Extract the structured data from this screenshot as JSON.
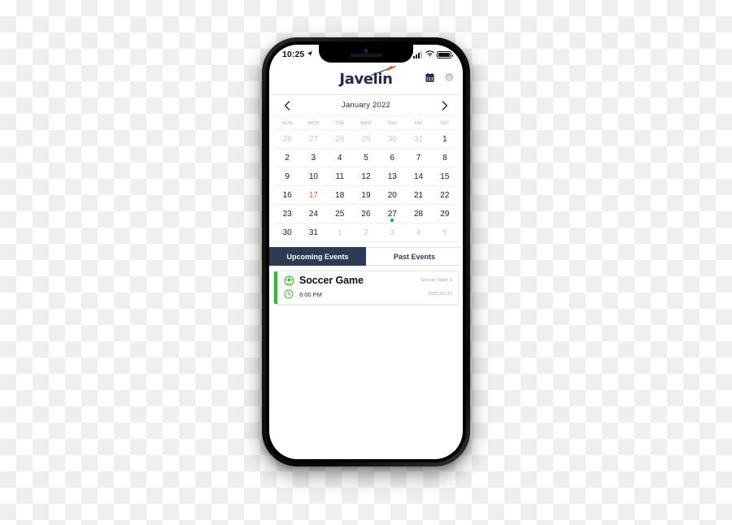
{
  "device": {
    "status_bar": {
      "time": "10:25",
      "location_icon": "location-arrow-icon",
      "signal_icon": "cellular-signal-icon",
      "wifi_icon": "wifi-icon",
      "battery_icon": "battery-full-icon"
    }
  },
  "app": {
    "brand": "Javelin",
    "brand_color": "#1d2b4c",
    "accent_color": "#21c521",
    "today_color": "#e8562a",
    "tab_active_bg": "#2b3a55",
    "header_icons": [
      {
        "name": "calendar-icon",
        "label": "Calendar"
      },
      {
        "name": "gear-icon",
        "label": "Settings"
      }
    ]
  },
  "calendar": {
    "prev_label": "‹",
    "next_label": "›",
    "month_label": "January 2022",
    "day_headers": [
      "SUN",
      "MON",
      "TUE",
      "WED",
      "THU",
      "FRI",
      "SAT"
    ],
    "weeks": [
      [
        {
          "day": "26",
          "state": "muted"
        },
        {
          "day": "27",
          "state": "muted"
        },
        {
          "day": "28",
          "state": "muted"
        },
        {
          "day": "29",
          "state": "muted"
        },
        {
          "day": "30",
          "state": "muted"
        },
        {
          "day": "31",
          "state": "muted"
        },
        {
          "day": "1",
          "state": "normal"
        }
      ],
      [
        {
          "day": "2",
          "state": "normal"
        },
        {
          "day": "3",
          "state": "normal"
        },
        {
          "day": "4",
          "state": "normal"
        },
        {
          "day": "5",
          "state": "normal"
        },
        {
          "day": "6",
          "state": "normal"
        },
        {
          "day": "7",
          "state": "normal"
        },
        {
          "day": "8",
          "state": "normal"
        }
      ],
      [
        {
          "day": "9",
          "state": "normal"
        },
        {
          "day": "10",
          "state": "normal"
        },
        {
          "day": "11",
          "state": "normal"
        },
        {
          "day": "12",
          "state": "normal"
        },
        {
          "day": "13",
          "state": "normal"
        },
        {
          "day": "14",
          "state": "normal"
        },
        {
          "day": "15",
          "state": "normal"
        }
      ],
      [
        {
          "day": "16",
          "state": "normal"
        },
        {
          "day": "17",
          "state": "today"
        },
        {
          "day": "18",
          "state": "normal"
        },
        {
          "day": "19",
          "state": "normal"
        },
        {
          "day": "20",
          "state": "normal"
        },
        {
          "day": "21",
          "state": "normal"
        },
        {
          "day": "22",
          "state": "normal"
        }
      ],
      [
        {
          "day": "23",
          "state": "normal"
        },
        {
          "day": "24",
          "state": "normal"
        },
        {
          "day": "25",
          "state": "normal"
        },
        {
          "day": "26",
          "state": "normal"
        },
        {
          "day": "27",
          "state": "normal",
          "has_event": true
        },
        {
          "day": "28",
          "state": "normal"
        },
        {
          "day": "29",
          "state": "normal"
        }
      ],
      [
        {
          "day": "30",
          "state": "normal"
        },
        {
          "day": "31",
          "state": "normal"
        },
        {
          "day": "1",
          "state": "muted"
        },
        {
          "day": "2",
          "state": "muted"
        },
        {
          "day": "3",
          "state": "muted"
        },
        {
          "day": "4",
          "state": "muted"
        },
        {
          "day": "5",
          "state": "muted"
        }
      ]
    ]
  },
  "tabs": [
    {
      "label": "Upcoming Events",
      "active": true
    },
    {
      "label": "Past Events",
      "active": false
    }
  ],
  "events": [
    {
      "title": "Soccer Game",
      "team": "Soccer Team 1",
      "time": "6:00 PM",
      "date": "2022-01-27",
      "title_icon": "soccer-ball-icon",
      "time_icon": "clock-icon"
    }
  ]
}
